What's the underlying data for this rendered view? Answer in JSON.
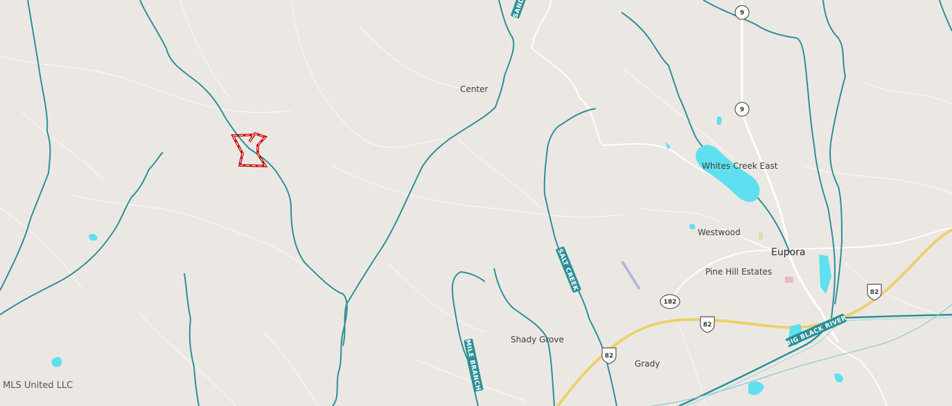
{
  "map": {
    "attribution": "MLS United LLC",
    "places": {
      "center": "Center",
      "whites_creek_east": "Whites Creek East",
      "westwood": "Westwood",
      "eupora": "Eupora",
      "pine_hill_estates": "Pine Hill Estates",
      "shady_grove": "Shady Grove",
      "grady": "Grady"
    },
    "waterways": {
      "sand_creek": "SAND",
      "salt_creek": "SALT CREEK",
      "mile_branch": "MILE BRANCH",
      "big_black_river": "BIG BLACK RIVER"
    },
    "routes": {
      "hwy9_north": "9",
      "hwy9_south": "9",
      "hwy182": "182",
      "us82_central": "82",
      "us82_east": "82",
      "us82_southwest": "82"
    },
    "colors": {
      "land": "#ebe8e3",
      "river": "#2c8f99",
      "water": "#5fe0f0",
      "highway": "#ecd16a",
      "parcel": "#c00000",
      "road": "#ffffff"
    }
  }
}
